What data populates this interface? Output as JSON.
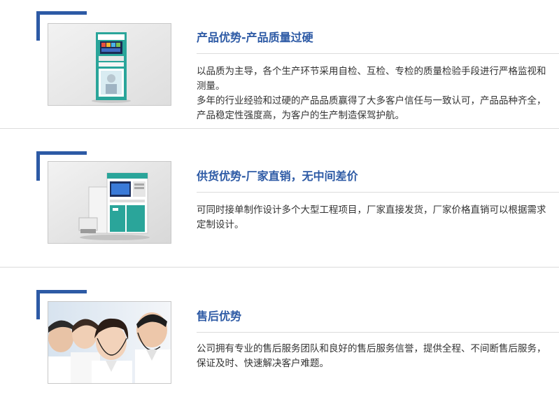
{
  "sections": [
    {
      "title": "产品优势-产品质量过硬",
      "paragraphs": [
        "以品质为主导，各个生产环节采用自检、互检、专检的质量检验手段进行严格监视和测量。",
        "多年的行业经验和过硬的产品品质赢得了大多客户信任与一致认可，产品品种齐全，产品稳定性强度高，为客户的生产制造保驾护航。"
      ],
      "image_icon": "kiosk-machine-photo"
    },
    {
      "title": "供货优势-厂家直销，无中间差价",
      "paragraphs": [
        "可同时接单制作设计多个大型工程项目，厂家直接发货，厂家价格直销可以根据需求定制设计。"
      ],
      "image_icon": "printer-terminal-photo"
    },
    {
      "title": "售后优势",
      "paragraphs": [
        "公司拥有专业的售后服务团队和良好的售后服务信誉，提供全程、不间断售后服务，保证及时、快速解决客户难题。"
      ],
      "image_icon": "customer-service-team-photo"
    }
  ],
  "colors": {
    "accent": "#2d5aa5",
    "divider": "#dcdcdc",
    "text": "#333333"
  }
}
